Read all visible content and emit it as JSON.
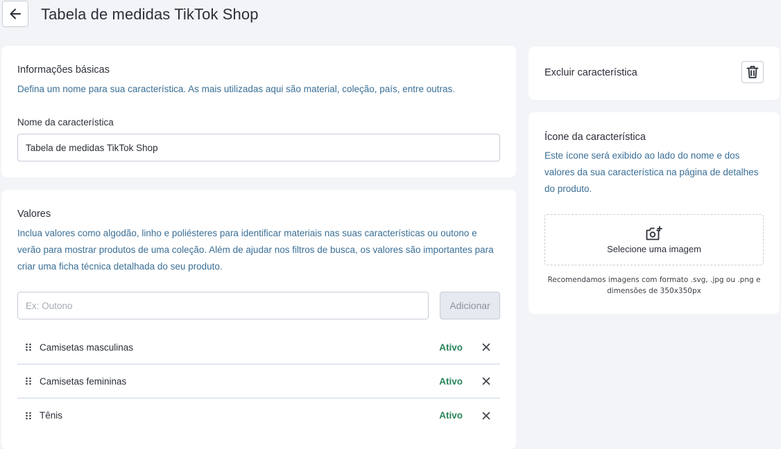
{
  "header": {
    "back_icon": "arrow-left-icon",
    "title": "Tabela de medidas TikTok Shop"
  },
  "basic_info": {
    "title": "Informações básicas",
    "description": "Defina um nome para sua característica. As mais utilizadas aqui são material, coleção, país, entre outras.",
    "name_label": "Nome da característica",
    "name_value": "Tabela de medidas TikTok Shop"
  },
  "values_section": {
    "title": "Valores",
    "description": "Inclua valores como algodão, linho e poliésteres para identificar materiais nas suas características ou outono e verão para mostrar produtos de uma coleção. Além de ajudar nos filtros de busca, os valores são importantes para criar uma ficha técnica detalhada do seu produto.",
    "input_placeholder": "Ex: Outono",
    "add_button": "Adicionar",
    "items": [
      {
        "name": "Camisetas masculinas",
        "status": "Ativo"
      },
      {
        "name": "Camisetas femininas",
        "status": "Ativo"
      },
      {
        "name": "Tênis",
        "status": "Ativo"
      }
    ]
  },
  "delete_section": {
    "title": "Excluir característica",
    "icon": "trash-icon"
  },
  "icon_section": {
    "title": "Ícone da característica",
    "description": "Este ícone será exibido ao lado do nome e dos valores da sua característica na página de detalhes do produto.",
    "upload_icon": "camera-plus-icon",
    "upload_label": "Selecione uma imagem",
    "hint": "Recomendamos imagens com formato .svg, .jpg ou .png e dimensões de 350x350px"
  },
  "colors": {
    "background": "#f3f4f8",
    "status_active": "#27855a",
    "description_text": "#3a6f96",
    "divider": "#c9d3e6"
  }
}
